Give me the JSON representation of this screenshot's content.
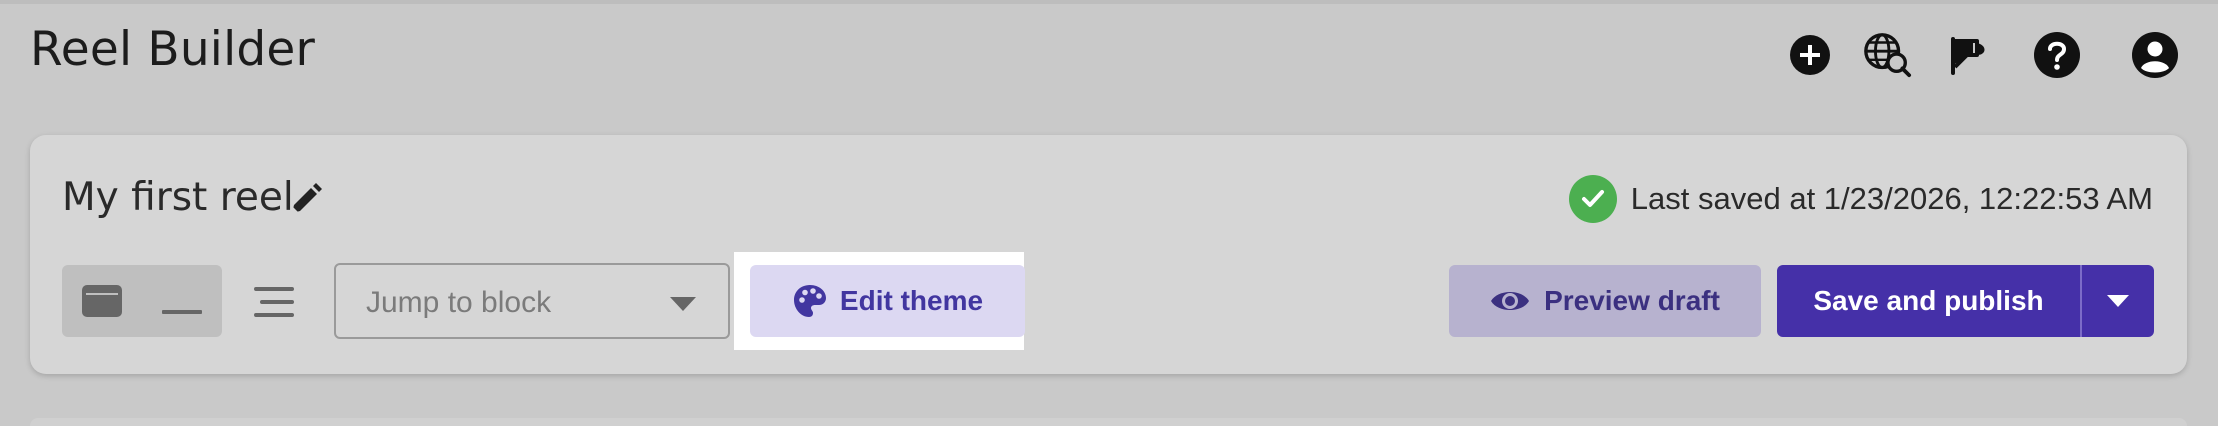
{
  "header": {
    "title": "Reel Builder",
    "icons": [
      "add-circle-icon",
      "globe-search-icon",
      "announcement-icon",
      "help-icon",
      "account-icon"
    ]
  },
  "reel": {
    "name": "My first reel",
    "status_text": "Last saved at 1/23/2026, 12:22:53 AM"
  },
  "toolbar": {
    "jump_placeholder": "Jump to block",
    "edit_theme_label": "Edit theme",
    "preview_label": "Preview draft",
    "publish_label": "Save and publish"
  },
  "colors": {
    "accent": "#4530a8",
    "accent_light": "#dcd8f2",
    "success": "#4caf50",
    "background": "#c9c9c9",
    "card": "#d6d6d6"
  }
}
